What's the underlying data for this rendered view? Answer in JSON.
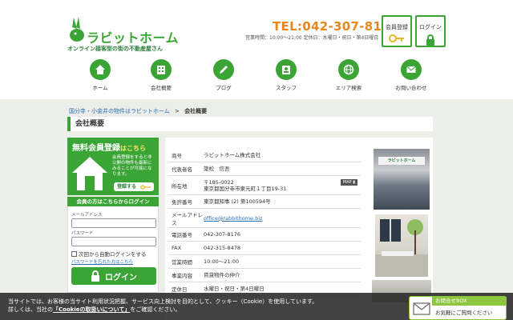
{
  "header": {
    "logo_text": "ラビットホーム",
    "tagline": "オンライン接客型の街の不動産屋さん",
    "tel": "TEL:042-307-8176",
    "hours": "営業時間：10:00〜21:00 定休日：水曜日・祝日・第4日曜日",
    "register_label": "会員登録",
    "login_label": "ログイン"
  },
  "nav": [
    {
      "label": "ホーム",
      "icon": "house-icon"
    },
    {
      "label": "会社概要",
      "icon": "building-icon"
    },
    {
      "label": "ブログ",
      "icon": "pencil-icon"
    },
    {
      "label": "スタッフ",
      "icon": "staff-icon"
    },
    {
      "label": "エリア検索",
      "icon": "globe-icon"
    },
    {
      "label": "お問い合わせ",
      "icon": "mail-icon"
    }
  ],
  "breadcrumb": {
    "home": "国分寺・小金井の物件はラビットホーム",
    "separator": ">",
    "current": "会社概要"
  },
  "page_title": "会社概要",
  "sidebar": {
    "reg_title_a": "無料会員登録",
    "reg_title_b": "はこちら",
    "reg_desc": "会員登録をすると非公開の物件も最新にみることが可能になります。",
    "reg_button": "登録する",
    "login_head": "会員の方はこちらからログイン",
    "email_label": "メールアドレス",
    "password_label": "パスワード",
    "remember": "次回から自動ログインをする",
    "forgot": "パスワードを忘れた方はこちら",
    "login_button": "ログイン"
  },
  "company": [
    {
      "key": "商号",
      "value": "ラビットホーム株式会社"
    },
    {
      "key": "代表者名",
      "value": "簗松　信吾"
    },
    {
      "key": "所在地",
      "value": "〒185-0022\n東京都国分寺市東元町１丁目19-31",
      "map": "MAP"
    },
    {
      "key": "免許番号",
      "value": "東京都知事 (2) 第100594号"
    },
    {
      "key": "メールアドレス",
      "value": "office@rabbithome.biz"
    },
    {
      "key": "電話番号",
      "value": "042-307-8176"
    },
    {
      "key": "FAX",
      "value": "042-315-8478"
    },
    {
      "key": "営業時間",
      "value": "10:00〜21:00"
    },
    {
      "key": "事業内容",
      "value": "賃貸物件の仲介"
    },
    {
      "key": "定休日",
      "value": "水曜日・祝日・第4日曜日"
    }
  ],
  "photo_sign": "ラビットホーム",
  "cookie": {
    "line1": "当サイトでは、お客様の当サイト利用状況把握、サービス向上検討を目的として、クッキー（Cookie）を使用しています。",
    "line2_a": "詳しくは、当社の",
    "line2_link": "「Cookieの取扱いについて」",
    "line2_b": "をご確認ください。"
  },
  "inquiry": {
    "title": "お問合せBOX",
    "sub": "お気軽にご質問ください"
  },
  "colors": {
    "brand": "#3aa535",
    "tel": "#e8871e",
    "link": "#2a6fb3"
  }
}
